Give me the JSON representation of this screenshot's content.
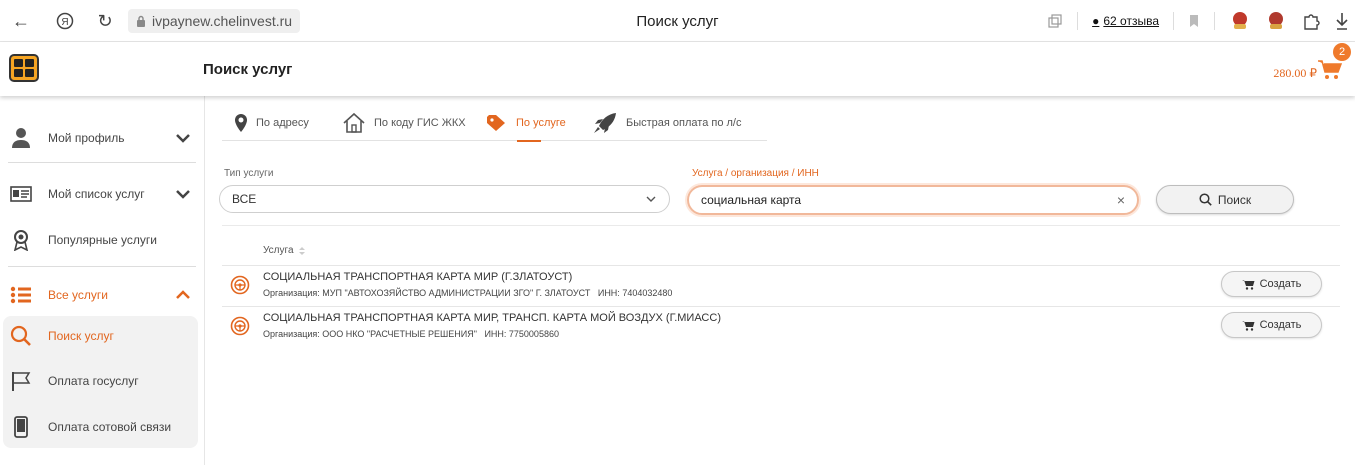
{
  "browser": {
    "url": "ivpaynew.chelinvest.ru",
    "tab_title": "Поиск услуг",
    "reviews": "62 отзыва"
  },
  "header": {
    "title": "Поиск услуг",
    "cart_total": "280.00 ₽",
    "cart_count": "2"
  },
  "sidebar": {
    "items": [
      {
        "label": "Мой профиль",
        "icon": "user-icon"
      },
      {
        "label": "Мой список услуг",
        "icon": "id-card-icon"
      },
      {
        "label": "Популярные услуги",
        "icon": "award-icon"
      },
      {
        "label": "Все услуги",
        "icon": "list-icon"
      },
      {
        "label": "Поиск услуг",
        "icon": "search-icon"
      },
      {
        "label": "Оплата госуслуг",
        "icon": "flag-icon"
      },
      {
        "label": "Оплата сотовой связи",
        "icon": "phone-icon"
      }
    ]
  },
  "tabs": [
    {
      "label": "По адресу",
      "icon": "location-pin-icon"
    },
    {
      "label": "По коду ГИС ЖКХ",
      "icon": "house-icon"
    },
    {
      "label": "По услуге",
      "icon": "tag-icon"
    },
    {
      "label": "Быстрая оплата по л/с",
      "icon": "rocket-icon"
    }
  ],
  "form": {
    "type_label": "Тип услуги",
    "type_value": "ВСЕ",
    "search_label": "Услуга / организация / ИНН",
    "search_value": "социальная карта",
    "search_button": "Поиск"
  },
  "table": {
    "column": "Услуга",
    "create_label": "Создать",
    "rows": [
      {
        "title": "СОЦИАЛЬНАЯ ТРАНСПОРТНАЯ КАРТА МИР (Г.ЗЛАТОУСТ)",
        "org": "Организация: МУП \"АВТОХОЗЯЙСТВО АДМИНИСТРАЦИИ ЗГО\" Г. ЗЛАТОУСТ",
        "inn": "ИНН: 7404032480"
      },
      {
        "title": "СОЦИАЛЬНАЯ ТРАНСПОРТНАЯ КАРТА МИР, ТРАНСП. КАРТА МОЙ ВОЗДУХ (Г.МИАСС)",
        "org": "Организация: ООО НКО \"РАСЧЕТНЫЕ РЕШЕНИЯ\"",
        "inn": "ИНН: 7750005860"
      }
    ]
  },
  "colors": {
    "accent": "#e2661f",
    "brand": "#f6a523"
  }
}
